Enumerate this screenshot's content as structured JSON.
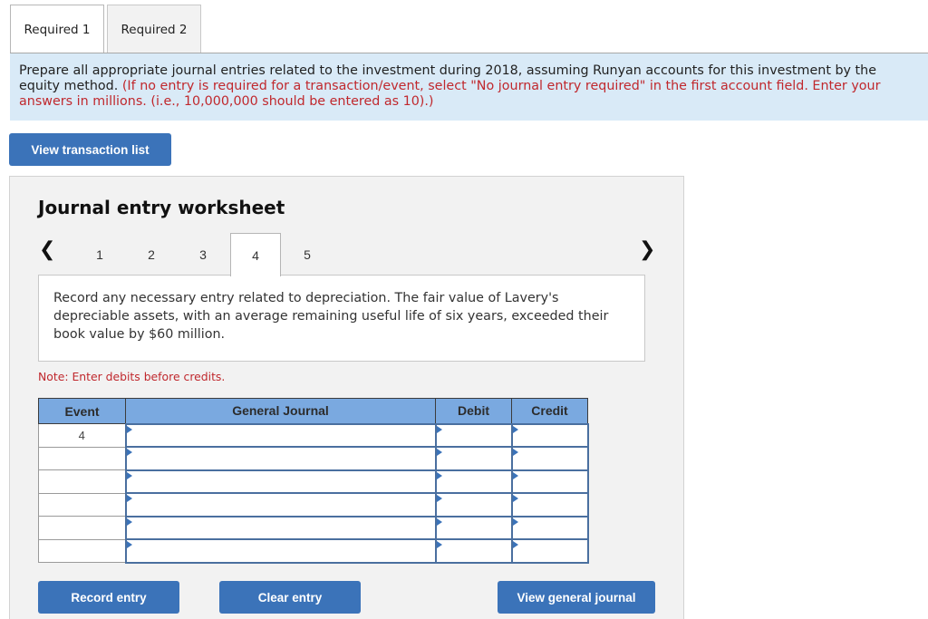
{
  "tabs": [
    {
      "label": "Required 1",
      "active": true
    },
    {
      "label": "Required 2",
      "active": false
    }
  ],
  "instructions": {
    "main": "Prepare all appropriate journal entries related to the investment during 2018, assuming Runyan accounts for this investment by the equity method.",
    "note": "(If no entry is required for a transaction/event, select \"No journal entry required\" in the first account field. Enter your answers in millions. (i.e., 10,000,000 should be entered as 10).)"
  },
  "buttons": {
    "view_transaction_list": "View transaction list",
    "record_entry": "Record entry",
    "clear_entry": "Clear entry",
    "view_general_journal": "View general journal"
  },
  "worksheet": {
    "title": "Journal entry worksheet",
    "prev_icon": "chevron-left-icon",
    "next_icon": "chevron-right-icon",
    "pages": [
      "1",
      "2",
      "3",
      "4",
      "5"
    ],
    "active_page": "4",
    "question": "Record any necessary entry related to depreciation. The fair value of Lavery's depreciable assets, with an average remaining useful life of six years, exceeded their book value by $60 million.",
    "note": "Note: Enter debits before credits."
  },
  "table": {
    "headers": [
      "Event",
      "General Journal",
      "Debit",
      "Credit"
    ],
    "rows": [
      {
        "event": "4",
        "account": "",
        "debit": "",
        "credit": ""
      },
      {
        "event": "",
        "account": "",
        "debit": "",
        "credit": ""
      },
      {
        "event": "",
        "account": "",
        "debit": "",
        "credit": ""
      },
      {
        "event": "",
        "account": "",
        "debit": "",
        "credit": ""
      },
      {
        "event": "",
        "account": "",
        "debit": "",
        "credit": ""
      },
      {
        "event": "",
        "account": "",
        "debit": "",
        "credit": ""
      }
    ]
  }
}
